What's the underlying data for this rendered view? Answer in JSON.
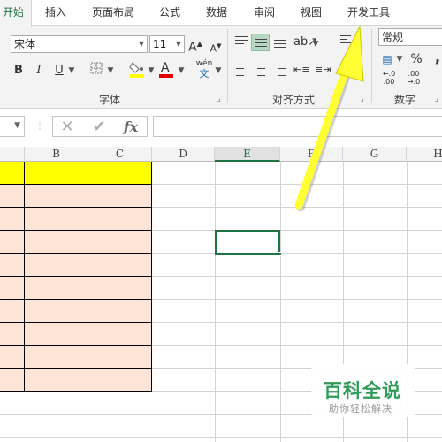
{
  "tabs": [
    "开始",
    "插入",
    "页面布局",
    "公式",
    "数据",
    "审阅",
    "视图",
    "开发工具"
  ],
  "active_tab": "开始",
  "font": {
    "name": "宋体",
    "size": "11",
    "grow_label": "A",
    "shrink_label": "A",
    "bold_label": "B",
    "italic_label": "I",
    "underline_label": "U",
    "phonetic_label": "wén",
    "group_label": "字体"
  },
  "alignment": {
    "group_label": "对齐方式"
  },
  "number": {
    "format": "常规",
    "percent_label": "%",
    "comma_label": ",",
    "group_label": "数字"
  },
  "formula_bar": {
    "fx_label": "fx",
    "value": ""
  },
  "columns": [
    "B",
    "C",
    "D",
    "E",
    "F",
    "G",
    "H"
  ],
  "selected_column": "E",
  "watermark": {
    "title": "百科全说",
    "subtitle": "助你轻松解决"
  },
  "colors": {
    "accent": "#217346",
    "header_fill": "#ffff00",
    "table_fill": "#fce4d6",
    "arrow": "#ffff33",
    "font_color_bar": "#e00000",
    "highlight_bar": "#ffff00"
  }
}
